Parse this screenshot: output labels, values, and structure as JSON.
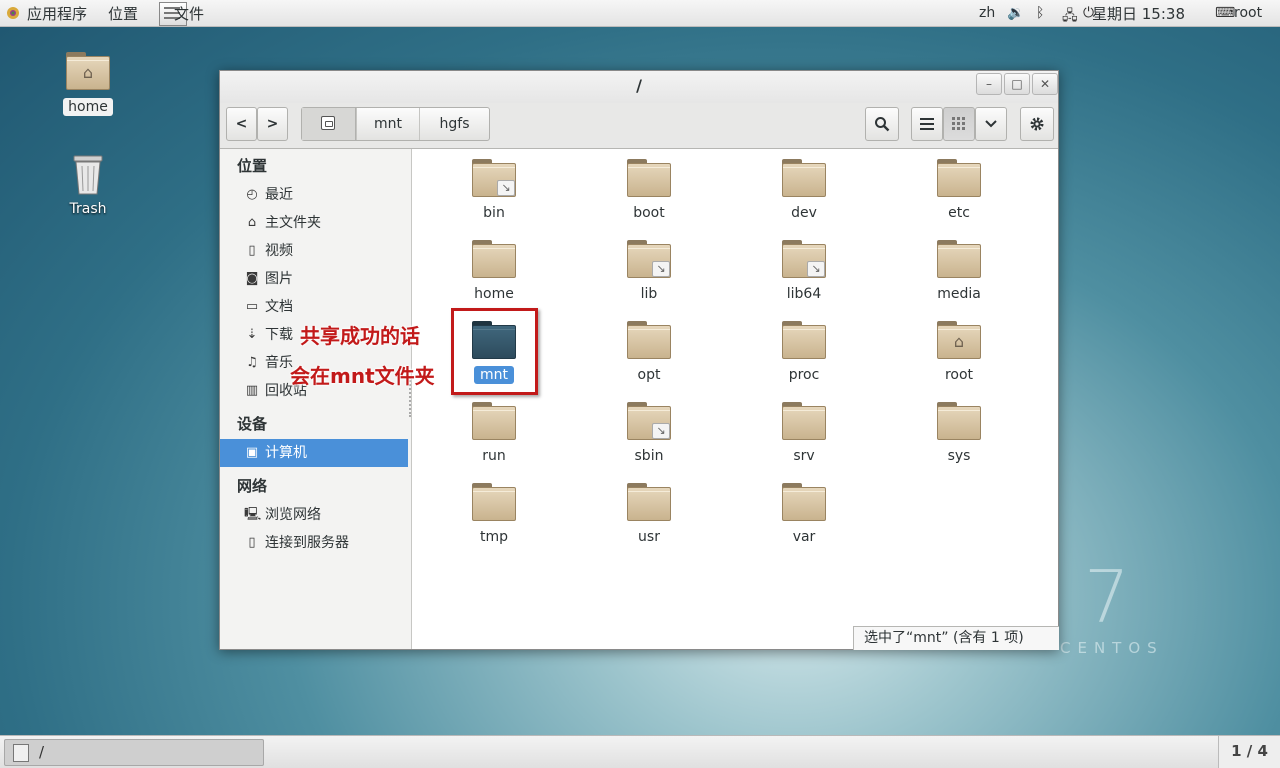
{
  "topbar": {
    "applications": "应用程序",
    "places": "位置",
    "files_app": "文件",
    "lang": "zh",
    "clock": "星期日 15:38",
    "user": "root"
  },
  "desktop": {
    "home_label": "home",
    "trash_label": "Trash"
  },
  "window": {
    "title": "/",
    "minimize": "–",
    "maximize": "□",
    "close": "✕"
  },
  "pathbar": {
    "segments": [
      "mnt",
      "hgfs"
    ]
  },
  "toolbar": {
    "back": "<",
    "forward": ">",
    "search_icon": "search-icon",
    "list_icon": "list-icon",
    "grid_icon": "grid-icon",
    "dropdown_icon": "chevron-down-icon",
    "settings_icon": "gear-icon"
  },
  "sidebar": {
    "places_header": "位置",
    "places": [
      {
        "label": "最近",
        "icon": "clock-icon"
      },
      {
        "label": "主文件夹",
        "icon": "home-icon"
      },
      {
        "label": "视频",
        "icon": "film-icon"
      },
      {
        "label": "图片",
        "icon": "camera-icon"
      },
      {
        "label": "文档",
        "icon": "document-icon"
      },
      {
        "label": "下载",
        "icon": "download-icon"
      },
      {
        "label": "音乐",
        "icon": "music-icon"
      },
      {
        "label": "回收站",
        "icon": "trash-icon"
      }
    ],
    "devices_header": "设备",
    "devices": [
      {
        "label": "计算机",
        "icon": "computer-icon",
        "selected": true
      }
    ],
    "network_header": "网络",
    "network": [
      {
        "label": "浏览网络",
        "icon": "network-icon"
      },
      {
        "label": "连接到服务器",
        "icon": "server-icon"
      }
    ]
  },
  "files": [
    {
      "name": "bin",
      "link": true
    },
    {
      "name": "boot"
    },
    {
      "name": "dev"
    },
    {
      "name": "etc"
    },
    {
      "name": "home"
    },
    {
      "name": "lib",
      "link": true
    },
    {
      "name": "lib64",
      "link": true
    },
    {
      "name": "media"
    },
    {
      "name": "mnt",
      "selected": true
    },
    {
      "name": "opt"
    },
    {
      "name": "proc"
    },
    {
      "name": "root",
      "home": true
    },
    {
      "name": "run"
    },
    {
      "name": "sbin",
      "link": true
    },
    {
      "name": "srv"
    },
    {
      "name": "sys"
    },
    {
      "name": "tmp"
    },
    {
      "name": "usr"
    },
    {
      "name": "var"
    }
  ],
  "status": "选中了“mnt” (含有 1 项)",
  "annotation": {
    "line1": "共享成功的话",
    "line2": "会在mnt文件夹"
  },
  "taskbar": {
    "window_label": "/",
    "workspace": "1 / 4"
  },
  "branding": {
    "version": "7",
    "name": "CENTOS"
  },
  "colors": {
    "selection": "#4a90d9",
    "annotation": "#c21a1a",
    "folder": "#d8c6a5"
  }
}
